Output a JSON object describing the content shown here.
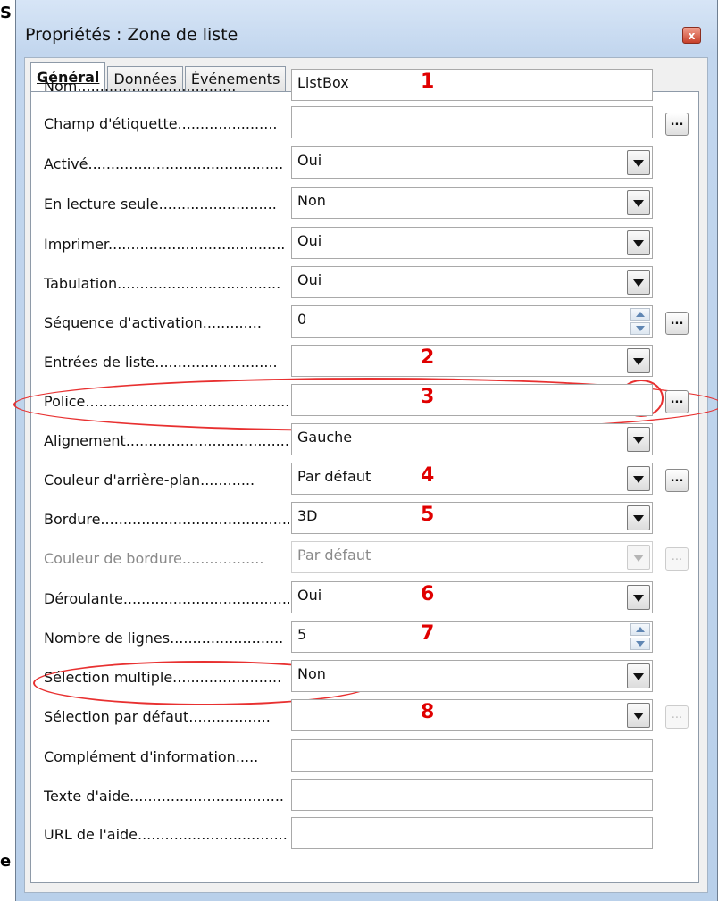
{
  "edge_chars": {
    "top": "S",
    "bottom": "e"
  },
  "dialog": {
    "title": "Propriétés : Zone de liste",
    "close_symbol": "x"
  },
  "tabs": [
    {
      "label": "Général",
      "active": true
    },
    {
      "label": "Données",
      "active": false
    },
    {
      "label": "Événements",
      "active": false
    }
  ],
  "rows": [
    {
      "label": "Nom...................................",
      "value": "ListBox",
      "type": "text",
      "annotation": "1"
    },
    {
      "label": "Champ d'étiquette......................",
      "value": "",
      "type": "text-more"
    },
    {
      "label": "Activé...........................................",
      "value": "Oui",
      "type": "dropdown"
    },
    {
      "label": "En lecture seule..........................",
      "value": "Non",
      "type": "dropdown"
    },
    {
      "label": "Imprimer.......................................",
      "value": "Oui",
      "type": "dropdown"
    },
    {
      "label": "Tabulation....................................",
      "value": "Oui",
      "type": "dropdown"
    },
    {
      "label": "Séquence d'activation.............",
      "value": "0",
      "type": "spin-more"
    },
    {
      "label": "Entrées de liste...........................",
      "value": "",
      "type": "dropdown",
      "annotation": "2"
    },
    {
      "label": "Police................................................",
      "value": "",
      "type": "text-more",
      "annotation": "3"
    },
    {
      "label": "Alignement.........................................",
      "value": "Gauche",
      "type": "dropdown"
    },
    {
      "label": "Couleur d'arrière-plan............",
      "value": "Par défaut",
      "type": "dropdown-more",
      "annotation": "4"
    },
    {
      "label": "Bordure...........................................",
      "value": "3D",
      "type": "dropdown",
      "annotation": "5"
    },
    {
      "label": "Couleur de bordure..................",
      "value": "Par défaut",
      "type": "dropdown-more",
      "disabled": true
    },
    {
      "label": "Déroulante......................................",
      "value": "Oui",
      "type": "dropdown",
      "annotation": "6"
    },
    {
      "label": "Nombre de lignes.........................",
      "value": "5",
      "type": "spin",
      "annotation": "7"
    },
    {
      "label": "Sélection multiple........................",
      "value": "Non",
      "type": "dropdown"
    },
    {
      "label": "Sélection par défaut..................",
      "value": "",
      "type": "dropdown-more-disabled",
      "annotation": "8"
    },
    {
      "label": "Complément d'information.....",
      "value": "",
      "type": "text"
    },
    {
      "label": "Texte d'aide..................................",
      "value": "",
      "type": "text"
    },
    {
      "label": "URL de l'aide.................................",
      "value": "",
      "type": "text"
    }
  ],
  "more_button_label": "...",
  "annotation_color": "#e00000"
}
